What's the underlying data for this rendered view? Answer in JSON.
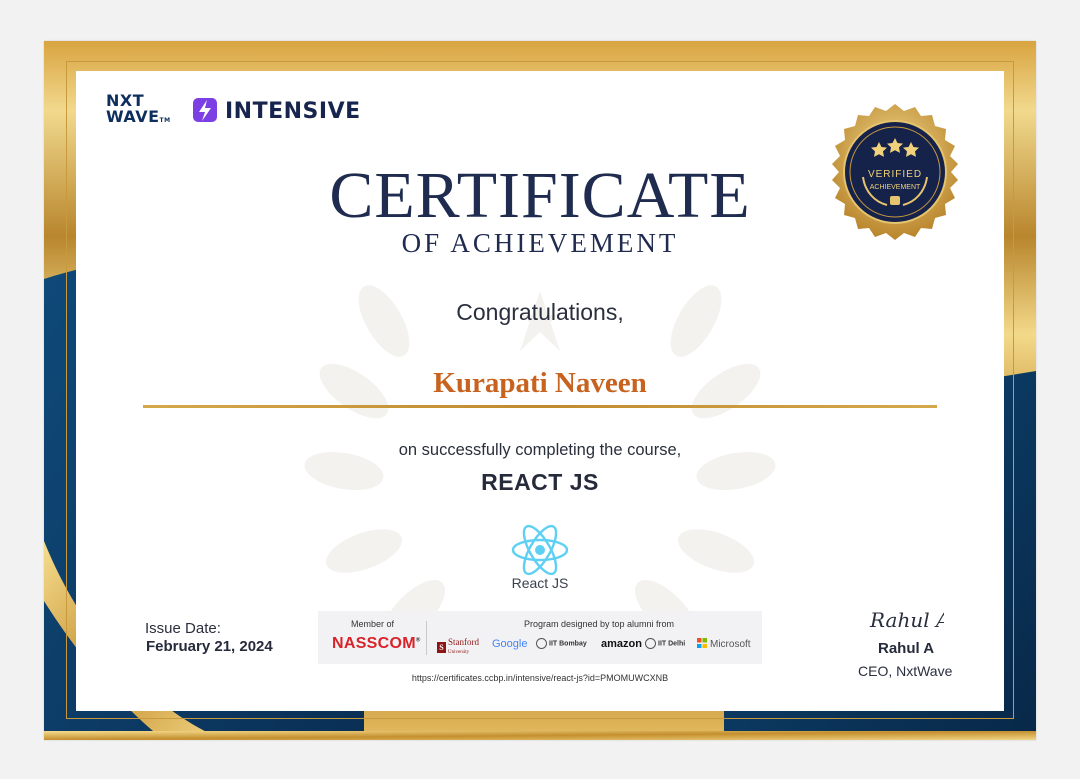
{
  "brand": {
    "nxtwave_line1": "NXT",
    "nxtwave_line2": "WAVE",
    "nxtwave_tm": "TM",
    "intensive": "INTENSIVE"
  },
  "title": "CERTIFICATE",
  "subtitle": "OF ACHIEVEMENT",
  "congrats": "Congratulations,",
  "recipient": "Kurapati Naveen",
  "completing_text": "on successfully completing the course,",
  "course": "REACT JS",
  "course_icon_label": "React JS",
  "issue": {
    "label": "Issue Date:",
    "date": "February 21, 2024"
  },
  "seal": {
    "line1": "VERIFIED",
    "line2": "ACHIEVEMENT"
  },
  "partners": {
    "member_label": "Member of",
    "member": "NASSCOM",
    "program_label": "Program designed by top alumni from",
    "stanford": "Stanford",
    "stanford_sub": "University",
    "google": "Google",
    "iit_bombay": "IIT Bombay",
    "amazon": "amazon",
    "iit_delhi": "IIT Delhi",
    "microsoft": "Microsoft"
  },
  "url": "https://certificates.ccbp.in/intensive/react-js?id=PMOMUWCXNB",
  "signatory": {
    "signature": "Rahul A",
    "name": "Rahul A",
    "title": "CEO, NxtWave"
  },
  "colors": {
    "navy": "#1f2b4f",
    "gold": "#c9993d",
    "name_orange": "#c8621f",
    "blue_band": "#0d3b66"
  }
}
